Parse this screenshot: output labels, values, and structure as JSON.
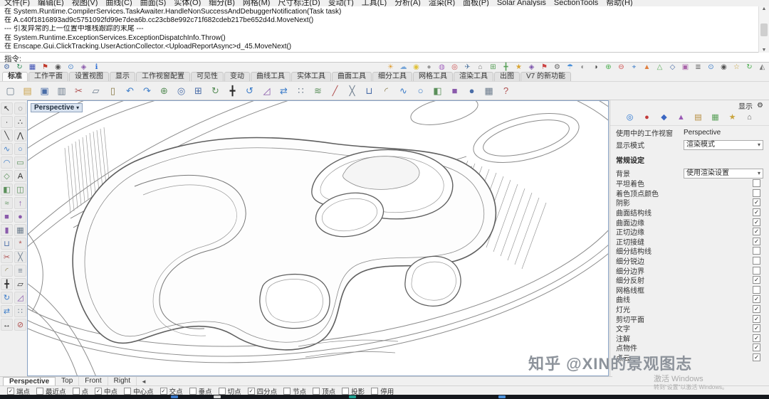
{
  "menu": {
    "items": [
      "文件(F)",
      "编辑(E)",
      "视图(V)",
      "曲线(C)",
      "曲面(S)",
      "实体(O)",
      "细分(B)",
      "网格(M)",
      "尺寸标注(D)",
      "变动(T)",
      "工具(L)",
      "分析(A)",
      "渲染(R)",
      "面板(P)",
      "Solar Analysis",
      "SectionTools",
      "帮助(H)"
    ]
  },
  "command": {
    "history": [
      "在 System.Runtime.CompilerServices.TaskAwaiter.HandleNonSuccessAndDebuggerNotification(Task task)",
      "在 A.c40f1816893ad9c5751092fd99e7dea6b.cc23cb8e992c71f682cdeb217be652d4d.MoveNext()",
      "--- 引发异常的上一位置中堆栈跟踪的末尾 ---",
      "在 System.Runtime.ExceptionServices.ExceptionDispatchInfo.Throw()",
      "在 Enscape.Gui.ClickTracking.UserActionCollector.<UploadReportAsync>d_45.MoveNext()"
    ],
    "prompt": "指令:"
  },
  "icons": {
    "caret_down": "▾",
    "scroll_up": "▲",
    "scroll_down": "▼",
    "tab_scroll": "◄",
    "gear": "⚙"
  },
  "toolbar_top": {
    "left_icons": [
      {
        "name": "options-gear-icon",
        "glyph": "⚙",
        "color": "#4a6da7"
      },
      {
        "name": "sync-icon",
        "glyph": "↻",
        "color": "#2e8b57"
      },
      {
        "name": "grid-icon",
        "glyph": "▦",
        "color": "#3f51b5"
      },
      {
        "name": "flag-icon",
        "glyph": "⚑",
        "color": "#c0392b"
      },
      {
        "name": "camera-icon",
        "glyph": "◉",
        "color": "#555555"
      },
      {
        "name": "eye-icon",
        "glyph": "⊙",
        "color": "#3d7dc9"
      },
      {
        "name": "gem-icon",
        "glyph": "◈",
        "color": "#8a5aab"
      },
      {
        "name": "info-icon",
        "glyph": "ℹ",
        "color": "#2b6cd4"
      }
    ],
    "right_icons": [
      {
        "name": "sun-icon",
        "glyph": "☀",
        "color": "#e0a23c"
      },
      {
        "name": "cloud-icon",
        "glyph": "☁",
        "color": "#79a7d9"
      },
      {
        "name": "bulb-icon",
        "glyph": "◉",
        "color": "#e0c23c"
      },
      {
        "name": "sphere-icon",
        "glyph": "●",
        "color": "#999999"
      },
      {
        "name": "material-ball-icon",
        "glyph": "◍",
        "color": "#a76bc2"
      },
      {
        "name": "target-icon",
        "glyph": "◎",
        "color": "#cc4f4f"
      },
      {
        "name": "walkthrough-icon",
        "glyph": "✈",
        "color": "#5b7fa6"
      },
      {
        "name": "home-icon",
        "glyph": "⌂",
        "color": "#767676"
      },
      {
        "name": "grid-snap-icon",
        "glyph": "⊞",
        "color": "#58a058"
      },
      {
        "name": "add-icon",
        "glyph": "╋",
        "color": "#58a058"
      },
      {
        "name": "star-icon",
        "glyph": "★",
        "color": "#d9a430"
      },
      {
        "name": "gem-icon",
        "glyph": "◈",
        "color": "#7b52ab"
      },
      {
        "name": "flag-icon",
        "glyph": "⚑",
        "color": "#cc4444"
      },
      {
        "name": "gear-icon",
        "glyph": "⚙",
        "color": "#666666"
      },
      {
        "name": "umbrella-icon",
        "glyph": "☂",
        "color": "#4a90d9"
      },
      {
        "name": "shade-left-icon",
        "glyph": "◐",
        "color": "#888888"
      },
      {
        "name": "shade-right-icon",
        "glyph": "◑",
        "color": "#444444"
      },
      {
        "name": "plus-circle-icon",
        "glyph": "⊕",
        "color": "#4caf50"
      },
      {
        "name": "minus-circle-icon",
        "glyph": "⊖",
        "color": "#d05050"
      },
      {
        "name": "crosshair-icon",
        "glyph": "⌖",
        "color": "#3d7dc9"
      },
      {
        "name": "triangle-icon",
        "glyph": "▲",
        "color": "#e07f3f"
      },
      {
        "name": "triangle-outline-icon",
        "glyph": "△",
        "color": "#5faf5f"
      },
      {
        "name": "diamond-icon",
        "glyph": "◇",
        "color": "#4a6da7"
      },
      {
        "name": "square-icon",
        "glyph": "▣",
        "color": "#aa66aa"
      },
      {
        "name": "layers-icon",
        "glyph": "≣",
        "color": "#666666"
      },
      {
        "name": "view-eye-icon",
        "glyph": "⊙",
        "color": "#3d7dc9"
      },
      {
        "name": "snapshot-icon",
        "glyph": "◉",
        "color": "#555555"
      },
      {
        "name": "star-outline-icon",
        "glyph": "☆",
        "color": "#c9a43d"
      },
      {
        "name": "refresh-icon",
        "glyph": "↻",
        "color": "#4caf50"
      },
      {
        "name": "cone-icon",
        "glyph": "◭",
        "color": "#777777"
      }
    ]
  },
  "tabs": {
    "items": [
      {
        "label": "标准",
        "active": true
      },
      {
        "label": "工作平面",
        "active": false
      },
      {
        "label": "设置视图",
        "active": false
      },
      {
        "label": "显示",
        "active": false
      },
      {
        "label": "工作视窗配置",
        "active": false
      },
      {
        "label": "可见性",
        "active": false
      },
      {
        "label": "变动",
        "active": false
      },
      {
        "label": "曲线工具",
        "active": false
      },
      {
        "label": "实体工具",
        "active": false
      },
      {
        "label": "曲面工具",
        "active": false
      },
      {
        "label": "细分工具",
        "active": false
      },
      {
        "label": "网格工具",
        "active": false
      },
      {
        "label": "渲染工具",
        "active": false
      },
      {
        "label": "出图",
        "active": false
      },
      {
        "label": "V7 的新功能",
        "active": false
      }
    ]
  },
  "toolbar_main": {
    "icons": [
      {
        "name": "new-file-icon",
        "glyph": "▢",
        "color": "#6b7b8c"
      },
      {
        "name": "open-file-icon",
        "glyph": "▤",
        "color": "#caa14a"
      },
      {
        "name": "save-file-icon",
        "glyph": "▣",
        "color": "#4a6da7"
      },
      {
        "name": "print-icon",
        "glyph": "▥",
        "color": "#6b7b8c"
      },
      {
        "name": "cut-icon",
        "glyph": "✂",
        "color": "#b05050"
      },
      {
        "name": "copy-icon",
        "glyph": "▱",
        "color": "#6b7b8c"
      },
      {
        "name": "paste-icon",
        "glyph": "▯",
        "color": "#8a7b4a"
      },
      {
        "name": "undo-icon",
        "glyph": "↶",
        "color": "#3d7dc9"
      },
      {
        "name": "redo-icon",
        "glyph": "↷",
        "color": "#3d7dc9"
      },
      {
        "name": "pan-icon",
        "glyph": "⊕",
        "color": "#5a8f5a"
      },
      {
        "name": "zoom-icon",
        "glyph": "◎",
        "color": "#4a6da7"
      },
      {
        "name": "zoom-extents-icon",
        "glyph": "⊞",
        "color": "#4a6da7"
      },
      {
        "name": "rotate-view-icon",
        "glyph": "↻",
        "color": "#5a8f5a"
      },
      {
        "name": "move-icon",
        "glyph": "╋",
        "color": "#2a2a2a"
      },
      {
        "name": "rotate-icon",
        "glyph": "↺",
        "color": "#3d7dc9"
      },
      {
        "name": "scale-icon",
        "glyph": "◿",
        "color": "#8a5aab"
      },
      {
        "name": "mirror-icon",
        "glyph": "⇄",
        "color": "#3d7dc9"
      },
      {
        "name": "array-icon",
        "glyph": "∷",
        "color": "#6b7b8c"
      },
      {
        "name": "offset-icon",
        "glyph": "≋",
        "color": "#5a8f5a"
      },
      {
        "name": "trim-icon",
        "glyph": "╱",
        "color": "#b05050"
      },
      {
        "name": "split-icon",
        "glyph": "╳",
        "color": "#6b7b8c"
      },
      {
        "name": "join-icon",
        "glyph": "⊔",
        "color": "#4a6da7"
      },
      {
        "name": "fillet-icon",
        "glyph": "◜",
        "color": "#8a7b4a"
      },
      {
        "name": "curve-icon",
        "glyph": "∿",
        "color": "#3d7dc9"
      },
      {
        "name": "circle-icon",
        "glyph": "○",
        "color": "#3d7dc9"
      },
      {
        "name": "surface-icon",
        "glyph": "◧",
        "color": "#5a8f5a"
      },
      {
        "name": "box-icon",
        "glyph": "■",
        "color": "#8a5aab"
      },
      {
        "name": "sphere-icon",
        "glyph": "●",
        "color": "#4a6da7"
      },
      {
        "name": "mesh-icon",
        "glyph": "▦",
        "color": "#6b7b8c"
      },
      {
        "name": "help-icon",
        "glyph": "?",
        "color": "#b05050"
      }
    ]
  },
  "sidebar": {
    "icons": [
      {
        "name": "select-arrow-icon",
        "glyph": "↖",
        "color": "#2a2a2a"
      },
      {
        "name": "lasso-icon",
        "glyph": "◌",
        "color": "#2a2a2a"
      },
      {
        "name": "point-icon",
        "glyph": "∙",
        "color": "#2a2a2a"
      },
      {
        "name": "point-cloud-icon",
        "glyph": "∴",
        "color": "#2a2a2a"
      },
      {
        "name": "line-icon",
        "glyph": "╲",
        "color": "#2a2a2a"
      },
      {
        "name": "polyline-icon",
        "glyph": "⋀",
        "color": "#2a2a2a"
      },
      {
        "name": "curve-icon",
        "glyph": "∿",
        "color": "#3d7dc9"
      },
      {
        "name": "circle-icon",
        "glyph": "○",
        "color": "#3d7dc9"
      },
      {
        "name": "arc-icon",
        "glyph": "◠",
        "color": "#3d7dc9"
      },
      {
        "name": "rectangle-icon",
        "glyph": "▭",
        "color": "#5a8f5a"
      },
      {
        "name": "polygon-icon",
        "glyph": "◇",
        "color": "#5a8f5a"
      },
      {
        "name": "text-icon",
        "glyph": "A",
        "color": "#2a2a2a"
      },
      {
        "name": "surface-icon",
        "glyph": "◧",
        "color": "#5a8f5a"
      },
      {
        "name": "plane-icon",
        "glyph": "◫",
        "color": "#5a8f5a"
      },
      {
        "name": "loft-icon",
        "glyph": "≈",
        "color": "#5a8f5a"
      },
      {
        "name": "extrude-icon",
        "glyph": "↑",
        "color": "#8a5aab"
      },
      {
        "name": "box-icon",
        "glyph": "■",
        "color": "#8a5aab"
      },
      {
        "name": "sphere-icon",
        "glyph": "●",
        "color": "#8a5aab"
      },
      {
        "name": "cylinder-icon",
        "glyph": "▮",
        "color": "#8a5aab"
      },
      {
        "name": "mesh-icon",
        "glyph": "▦",
        "color": "#6b7b8c"
      },
      {
        "name": "join-icon",
        "glyph": "⊔",
        "color": "#4a6da7"
      },
      {
        "name": "explode-icon",
        "glyph": "*",
        "color": "#b05050"
      },
      {
        "name": "trim-icon",
        "glyph": "✂",
        "color": "#b05050"
      },
      {
        "name": "split-icon",
        "glyph": "╳",
        "color": "#6b7b8c"
      },
      {
        "name": "fillet-icon",
        "glyph": "◜",
        "color": "#8a7b4a"
      },
      {
        "name": "offset-icon",
        "glyph": "≡",
        "color": "#6b7b8c"
      },
      {
        "name": "move-icon",
        "glyph": "╋",
        "color": "#2a2a2a"
      },
      {
        "name": "copy-icon",
        "glyph": "▱",
        "color": "#2a2a2a"
      },
      {
        "name": "rotate-icon",
        "glyph": "↻",
        "color": "#3d7dc9"
      },
      {
        "name": "scale-icon",
        "glyph": "◿",
        "color": "#8a5aab"
      },
      {
        "name": "mirror-icon",
        "glyph": "⇄",
        "color": "#3d7dc9"
      },
      {
        "name": "array-icon",
        "glyph": "∷",
        "color": "#6b7b8c"
      },
      {
        "name": "dimension-icon",
        "glyph": "↔",
        "color": "#2a2a2a"
      },
      {
        "name": "hide-icon",
        "glyph": "⊘",
        "color": "#b05050"
      }
    ]
  },
  "viewport": {
    "label": "Perspective",
    "tabs": [
      {
        "label": "Perspective",
        "active": true
      },
      {
        "label": "Top",
        "active": false
      },
      {
        "label": "Front",
        "active": false
      },
      {
        "label": "Right",
        "active": false
      }
    ]
  },
  "display_panel": {
    "title": "显示",
    "tab_icons": [
      {
        "name": "display-panel-tab-icon",
        "glyph": "◎",
        "color": "#1f6fd0"
      },
      {
        "name": "properties-panel-tab-icon",
        "glyph": "●",
        "color": "#c23b3b"
      },
      {
        "name": "layers-panel-tab-icon",
        "glyph": "◆",
        "color": "#3b67c2"
      },
      {
        "name": "materials-panel-tab-icon",
        "glyph": "▲",
        "color": "#9a5ab5"
      },
      {
        "name": "libraries-panel-tab-icon",
        "glyph": "▤",
        "color": "#b58a3a"
      },
      {
        "name": "rendering-panel-tab-icon",
        "glyph": "▦",
        "color": "#58a058"
      },
      {
        "name": "lights-panel-tab-icon",
        "glyph": "★",
        "color": "#c9a43d"
      },
      {
        "name": "help-panel-tab-icon",
        "glyph": "⌂",
        "color": "#666666"
      }
    ],
    "active_viewport_label": "使用中的工作视窗",
    "active_viewport_value": "Perspective",
    "display_mode_label": "显示模式",
    "display_mode_value": "渲染模式",
    "section_general": "常规设定",
    "background_label": "背景",
    "background_value": "使用渲染设置",
    "checkboxes": [
      {
        "label": "平坦着色",
        "checked": false
      },
      {
        "label": "着色顶点颜色",
        "checked": false
      },
      {
        "label": "阴影",
        "checked": true
      },
      {
        "label": "曲面结构线",
        "checked": true
      },
      {
        "label": "曲面边缘",
        "checked": true
      },
      {
        "label": "正切边缘",
        "checked": true
      },
      {
        "label": "正切接缝",
        "checked": true
      },
      {
        "label": "细分结构线",
        "checked": false
      },
      {
        "label": "细分锐边",
        "checked": false
      },
      {
        "label": "细分边界",
        "checked": false
      },
      {
        "label": "细分反射",
        "checked": true
      },
      {
        "label": "网格线框",
        "checked": false
      },
      {
        "label": "曲线",
        "checked": true
      },
      {
        "label": "灯光",
        "checked": true
      },
      {
        "label": "剪切平面",
        "checked": true
      },
      {
        "label": "文字",
        "checked": true
      },
      {
        "label": "注解",
        "checked": true
      },
      {
        "label": "点物件",
        "checked": true
      },
      {
        "label": "点云",
        "checked": true
      }
    ]
  },
  "statusbar": {
    "osnaps": [
      {
        "label": "端点",
        "checked": true
      },
      {
        "label": "最近点",
        "checked": false
      },
      {
        "label": "点",
        "checked": false
      },
      {
        "label": "中点",
        "checked": true
      },
      {
        "label": "中心点",
        "checked": false
      },
      {
        "label": "交点",
        "checked": true
      },
      {
        "label": "垂点",
        "checked": false
      },
      {
        "label": "切点",
        "checked": false
      },
      {
        "label": "四分点",
        "checked": true
      },
      {
        "label": "节点",
        "checked": false
      },
      {
        "label": "顶点",
        "checked": false
      },
      {
        "label": "投影",
        "checked": false
      },
      {
        "label": "停用",
        "checked": false
      }
    ]
  },
  "overlays": {
    "watermark": "知乎 @XIN的景观图志",
    "activate_line1": "激活 Windows",
    "activate_line2": "转到“设置”以激活 Windows。"
  }
}
